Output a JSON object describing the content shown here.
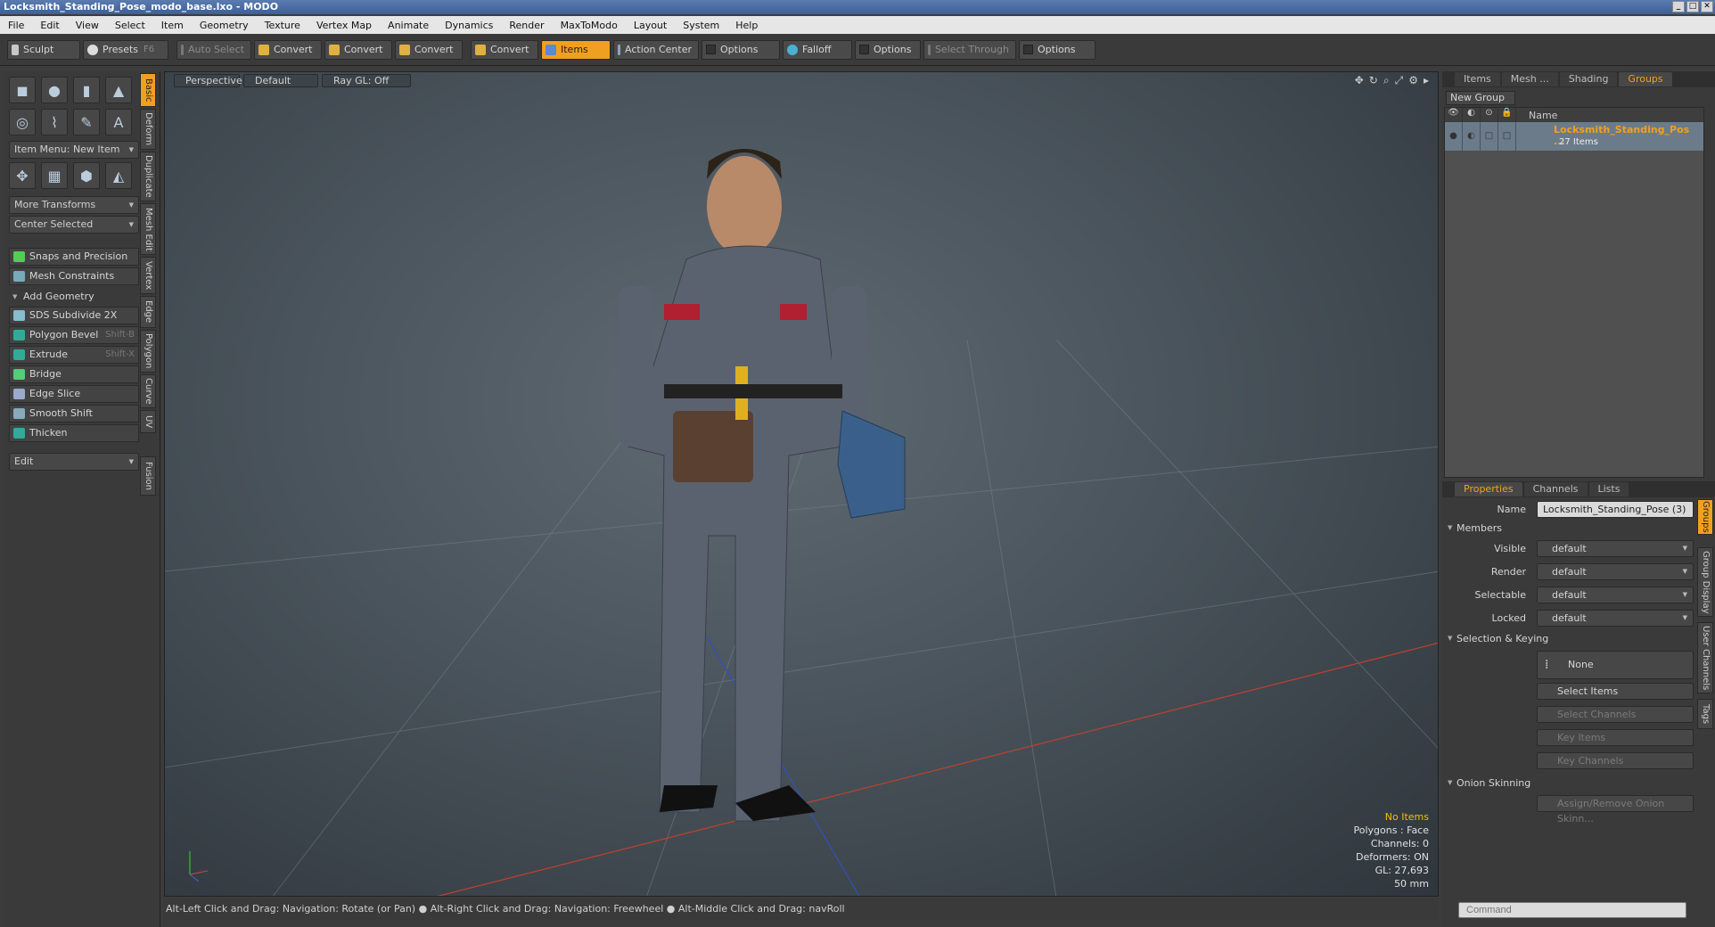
{
  "window": {
    "title": "Locksmith_Standing_Pose_modo_base.lxo - MODO"
  },
  "menu": [
    "File",
    "Edit",
    "View",
    "Select",
    "Item",
    "Geometry",
    "Texture",
    "Vertex Map",
    "Animate",
    "Dynamics",
    "Render",
    "MaxToModo",
    "Layout",
    "System",
    "Help"
  ],
  "toolbar": {
    "sculpt": "Sculpt",
    "presets": "Presets",
    "presets_hotkey": "F6",
    "auto_select": "Auto Select",
    "convert": "Convert",
    "items": "Items",
    "action_center": "Action Center",
    "options": "Options",
    "falloff": "Falloff",
    "select_through": "Select Through"
  },
  "left": {
    "item_menu": "Item Menu: New Item",
    "more_transforms": "More Transforms",
    "center_selected": "Center Selected",
    "snaps": "Snaps and Precision",
    "mesh_constraints": "Mesh Constraints",
    "add_geometry": "Add Geometry",
    "tools": [
      {
        "label": "SDS Subdivide 2X",
        "hotkey": ""
      },
      {
        "label": "Polygon Bevel",
        "hotkey": "Shift-B"
      },
      {
        "label": "Extrude",
        "hotkey": "Shift-X"
      },
      {
        "label": "Bridge",
        "hotkey": ""
      },
      {
        "label": "Edge Slice",
        "hotkey": ""
      },
      {
        "label": "Smooth Shift",
        "hotkey": ""
      },
      {
        "label": "Thicken",
        "hotkey": ""
      }
    ],
    "edit": "Edit",
    "vtabs": [
      "Basic",
      "Deform",
      "Duplicate",
      "Mesh Edit",
      "Vertex",
      "Edge",
      "Polygon",
      "Curve",
      "UV",
      "Fusion"
    ]
  },
  "viewport": {
    "perspective": "Perspective",
    "default": "Default",
    "raygl": "Ray GL: Off",
    "hud": {
      "no_items": "No Items",
      "polygons": "Polygons : Face",
      "channels": "Channels: 0",
      "deformers": "Deformers: ON",
      "gl": "GL: 27,693",
      "scale": "50 mm"
    }
  },
  "status": "Alt-Left Click and Drag: Navigation: Rotate (or Pan) ● Alt-Right Click and Drag: Navigation: Freewheel ● Alt-Middle Click and Drag: navRoll",
  "right": {
    "tabs_top": [
      "Items",
      "Mesh ...",
      "Shading",
      "Groups"
    ],
    "new_group": "New Group",
    "col_name": "Name",
    "group_name": "Locksmith_Standing_Pos ...",
    "group_count": "27 Items",
    "tabs_props": [
      "Properties",
      "Channels",
      "Lists"
    ],
    "name_label": "Name",
    "name_value": "Locksmith_Standing_Pose (3)",
    "members": "Members",
    "visible_label": "Visible",
    "render_label": "Render",
    "selectable_label": "Selectable",
    "locked_label": "Locked",
    "default": "default",
    "selection_keying": "Selection & Keying",
    "none": "None",
    "select_items": "Select Items",
    "select_channels": "Select Channels",
    "key_items": "Key Items",
    "key_channels": "Key Channels",
    "onion": "Onion Skinning",
    "assign_onion": "Assign/Remove Onion Skinn...",
    "vtabs": [
      "Groups",
      "Group Display",
      "User Channels",
      "Tags"
    ]
  },
  "command_placeholder": "Command"
}
